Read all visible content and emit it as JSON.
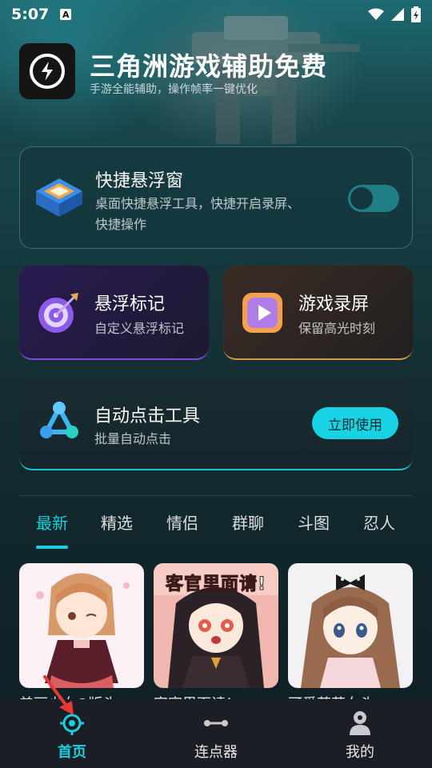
{
  "status_bar": {
    "time": "5:07",
    "notif_letter": "A"
  },
  "header": {
    "title": "三角洲游戏辅助免费",
    "subtitle": "手游全能辅助，操作帧率一键优化"
  },
  "float_card": {
    "title": "快捷悬浮窗",
    "desc_line1": "桌面快捷悬浮工具，快捷开启录屏、",
    "desc_line2": "快捷操作",
    "toggle_on": false
  },
  "mark_card": {
    "title": "悬浮标记",
    "desc": "自定义悬浮标记"
  },
  "record_card": {
    "title": "游戏录屏",
    "desc": "保留高光时刻"
  },
  "auto_card": {
    "title": "自动点击工具",
    "desc": "批量自动点击",
    "button": "立即使用"
  },
  "tabs": [
    {
      "label": "最新",
      "active": true
    },
    {
      "label": "精选"
    },
    {
      "label": "情侣"
    },
    {
      "label": "群聊"
    },
    {
      "label": "斗图"
    },
    {
      "label": "忍人"
    }
  ],
  "thumbnails": [
    {
      "caption": "美丽少女Q版头",
      "icon": "chibi-girl-red-dress"
    },
    {
      "caption": "客官里面请！",
      "overlay_text": "客官里面请!",
      "icon": "chibi-girl-black-hair"
    },
    {
      "caption": "可爱萌萌女头",
      "icon": "chibi-girl-polka-bow"
    }
  ],
  "bottom_nav": [
    {
      "label": "首页",
      "icon": "crosshair-icon",
      "active": true
    },
    {
      "label": "连点器",
      "icon": "connector-icon"
    },
    {
      "label": "我的",
      "icon": "profile-icon"
    }
  ],
  "colors": {
    "accent": "#1ad0dc",
    "mark_border": "#7d4be0",
    "record_border": "#d89a3c",
    "pointer": "#e53935"
  }
}
